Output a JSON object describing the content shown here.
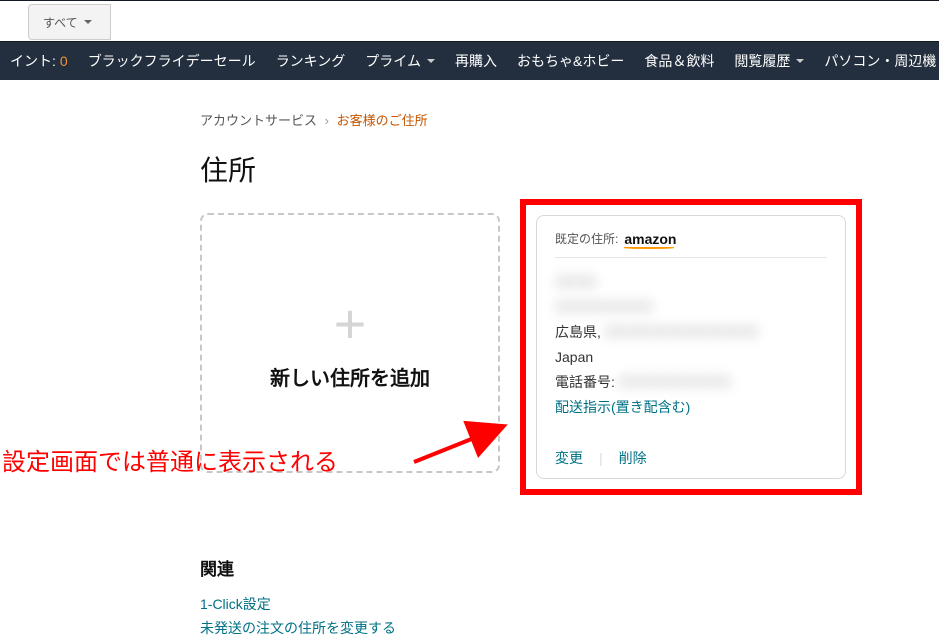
{
  "search": {
    "dropdown_label": "すべて"
  },
  "nav": {
    "points_prefix": "イント:",
    "points_value": "0",
    "items": [
      "ブラックフライデーセール",
      "ランキング",
      "プライム",
      "再購入",
      "おもちゃ&ホビー",
      "食品＆飲料",
      "閲覧履歴",
      "パソコン・周辺機"
    ]
  },
  "breadcrumb": {
    "root": "アカウントサービス",
    "current": "お客様のご住所"
  },
  "title": "住所",
  "add_card": {
    "label": "新しい住所を追加"
  },
  "address_card": {
    "default_prefix": "既定の住所:",
    "brand": "amazon",
    "name_blurred": "〇〇〇",
    "line2_blurred": "〇〇〇〇〇〇〇",
    "prefecture": "広島県,",
    "pref_rest_blurred": "〇〇〇〇〇〇〇〇〇〇〇",
    "country": "Japan",
    "phone_label": "電話番号:",
    "phone_blurred": "〇〇〇〇〇〇〇〇",
    "delivery_instructions": "配送指示(置き配含む)",
    "action_edit": "変更",
    "action_delete": "削除"
  },
  "annotation": {
    "text": "設定画面では普通に表示される"
  },
  "related": {
    "heading": "関連",
    "links": [
      "1-Click設定",
      "未発送の注文の住所を変更する"
    ]
  }
}
